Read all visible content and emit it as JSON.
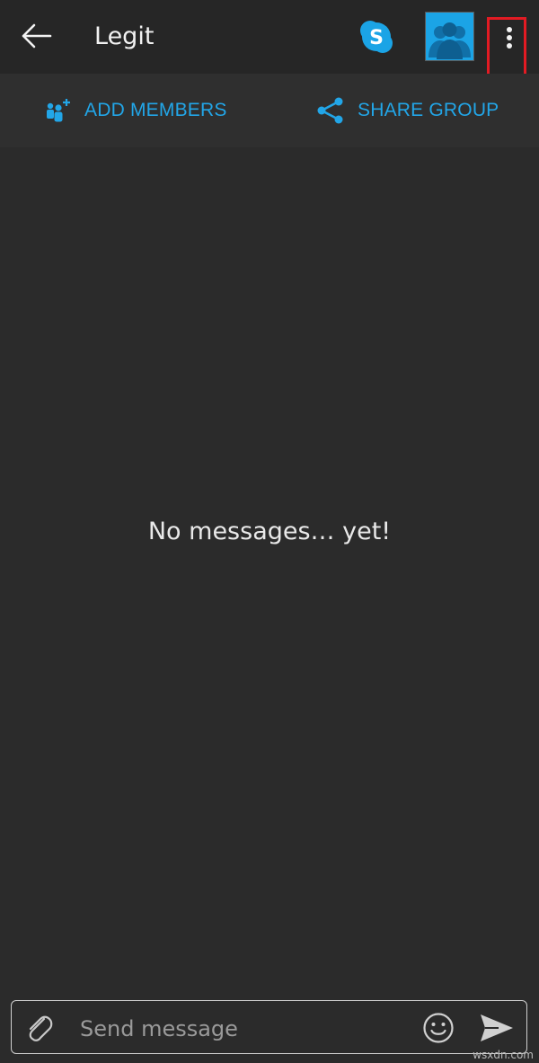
{
  "header": {
    "title": "Legit",
    "skype_icon_letter": "S",
    "back_icon": "arrow-left-icon",
    "avatar_icon": "group-avatar-icon",
    "more_icon": "more-vertical-icon"
  },
  "actions": {
    "add_members_label": "ADD MEMBERS",
    "share_group_label": "SHARE GROUP"
  },
  "conversation": {
    "empty_text": "No messages… yet!"
  },
  "composer": {
    "placeholder": "Send message",
    "value": ""
  },
  "colors": {
    "accent": "#22a6e8",
    "background": "#2b2b2b",
    "highlight": "#e21b23"
  },
  "watermark": "wsxdn.com"
}
